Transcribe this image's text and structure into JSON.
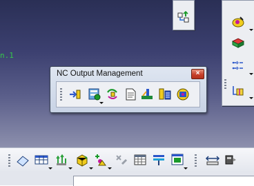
{
  "window": {
    "title": "NC Output Management",
    "close_glyph": "×"
  },
  "viewport_label": "n.1",
  "nc_toolbar": {
    "tools": [
      {
        "icon": "replay-icon",
        "has_dropdown": false
      },
      {
        "icon": "video-simulation-icon",
        "has_dropdown": true
      },
      {
        "icon": "generate-apt-icon",
        "has_dropdown": false
      },
      {
        "icon": "document-icon",
        "has_dropdown": false
      },
      {
        "icon": "machining-shop-icon",
        "has_dropdown": false
      },
      {
        "icon": "nc-output-icon",
        "has_dropdown": false
      },
      {
        "icon": "tool-change-icon",
        "has_dropdown": false
      }
    ]
  },
  "top_floating_toolbar": {
    "icon": "sequence-arrows-icon"
  },
  "right_toolbar": {
    "tools": [
      {
        "icon": "operation-yellow-icon",
        "has_dropdown": true
      },
      {
        "icon": "part-operation-icon",
        "has_dropdown": false
      },
      {
        "icon": "transition-path-icon",
        "has_dropdown": true
      },
      {
        "icon": "tool-path-icon",
        "has_dropdown": true
      }
    ]
  },
  "bottom_toolbar": {
    "tools": [
      {
        "icon": "eraser-icon",
        "has_dropdown": false
      },
      {
        "icon": "table-icon",
        "has_dropdown": true
      },
      {
        "icon": "tree-arrows-icon",
        "has_dropdown": true
      },
      {
        "icon": "material-icon",
        "has_dropdown": true
      },
      {
        "icon": "sequence-warning-icon",
        "has_dropdown": true
      },
      {
        "icon": "disabled-tool-icon",
        "has_dropdown": false
      },
      {
        "icon": "calendar-icon",
        "has_dropdown": false
      },
      {
        "icon": "feed-speed-icon",
        "has_dropdown": false
      },
      {
        "icon": "window-view-icon",
        "has_dropdown": true
      },
      {
        "icon": "measure-icon",
        "has_dropdown": false
      },
      {
        "icon": "inspect-icon",
        "has_dropdown": false
      }
    ]
  },
  "colors": {
    "workspace_top": "#2a2f55",
    "workspace_bottom": "#8d90ad",
    "close_red": "#c7402a"
  }
}
